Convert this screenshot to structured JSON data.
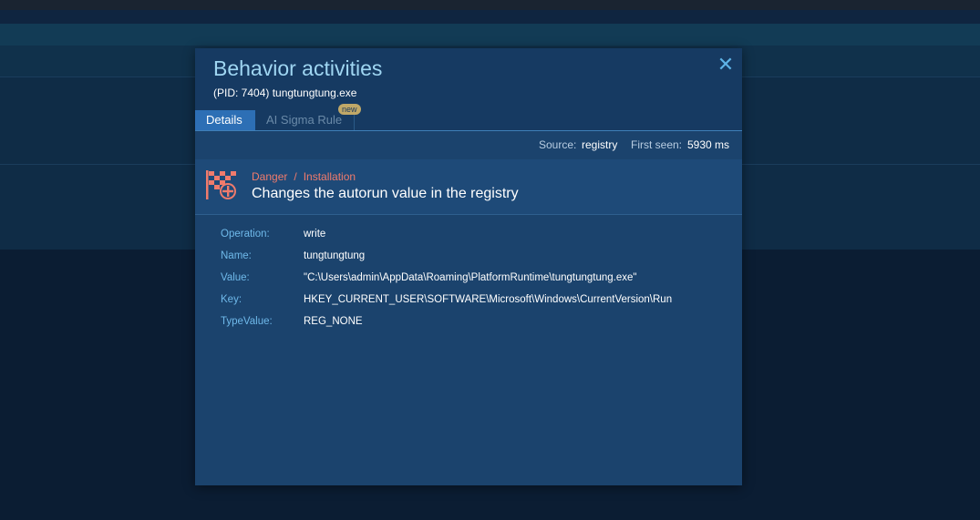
{
  "modal": {
    "title": "Behavior activities",
    "subtitle": "(PID: 7404) tungtungtung.exe",
    "close_icon": "close-icon",
    "tabs": [
      {
        "label": "Details",
        "active": true
      },
      {
        "label": "AI Sigma Rule",
        "active": false,
        "badge": "new"
      }
    ]
  },
  "source": {
    "source_label": "Source:",
    "source_value": "registry",
    "first_seen_label": "First seen:",
    "first_seen_value": "5930 ms"
  },
  "event": {
    "icon": "flag-plus-icon",
    "severity": "Danger",
    "separator": "/",
    "category": "Installation",
    "description": "Changes the autorun value in the registry",
    "color": "#f07b6c"
  },
  "details": [
    {
      "key": "Operation:",
      "value": "write"
    },
    {
      "key": "Name:",
      "value": "tungtungtung"
    },
    {
      "key": "Value:",
      "value": "\"C:\\Users\\admin\\AppData\\Roaming\\PlatformRuntime\\tungtungtung.exe\""
    },
    {
      "key": "Key:",
      "value": "HKEY_CURRENT_USER\\SOFTWARE\\Microsoft\\Windows\\CurrentVersion\\Run"
    },
    {
      "key": "TypeValue:",
      "value": "REG_NONE"
    }
  ]
}
